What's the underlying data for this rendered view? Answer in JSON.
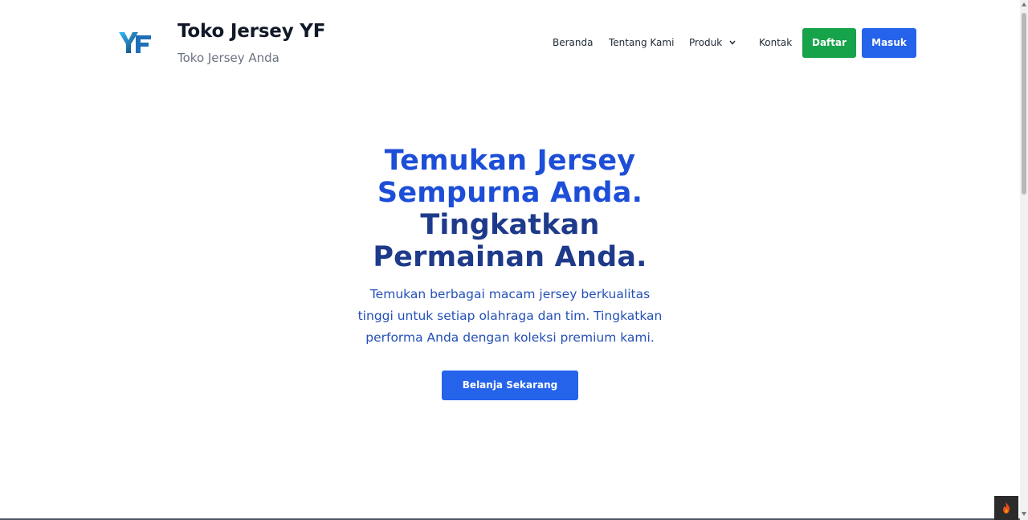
{
  "brand": {
    "logo_text": "YF",
    "title": "Toko Jersey YF",
    "subtitle": "Toko Jersey Anda"
  },
  "nav": {
    "items": [
      {
        "label": "Beranda"
      },
      {
        "label": "Tentang Kami"
      },
      {
        "label": "Produk",
        "icon": "chevron-down-icon"
      },
      {
        "label": "Kontak"
      }
    ],
    "register_label": "Daftar",
    "login_label": "Masuk"
  },
  "hero": {
    "title_line1": "Temukan Jersey Sempurna Anda.",
    "title_line2": "Tingkatkan",
    "title_line3": "Permainan Anda.",
    "description": "Temukan berbagai macam jersey berkualitas tinggi untuk setiap olahraga dan tim. Tingkatkan performa Anda dengan koleksi premium kami.",
    "cta_label": "Belanja Sekarang"
  },
  "colors": {
    "accent_blue": "#2563eb",
    "success_green": "#16a34a",
    "heading_blue": "#1d4ed8",
    "heading_navy": "#1e3a8a"
  },
  "debug_toolbar": {
    "icon": "flame-icon"
  }
}
